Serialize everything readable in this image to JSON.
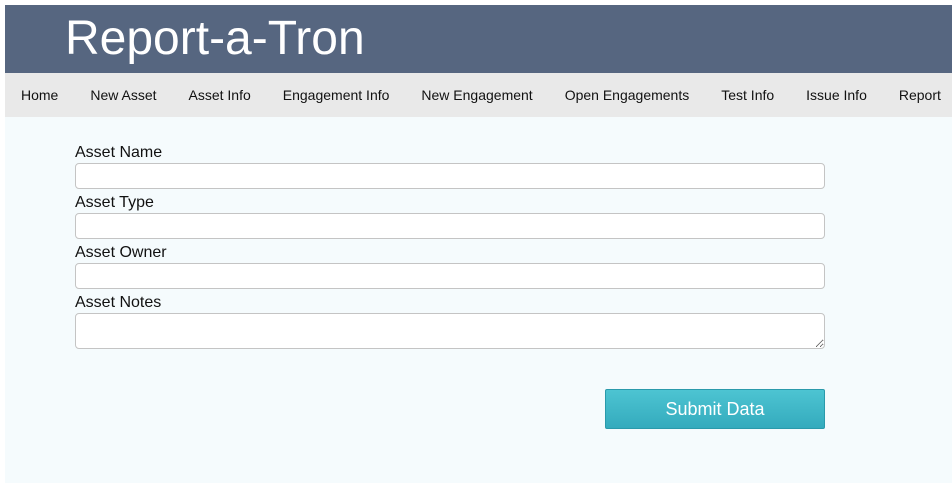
{
  "header": {
    "title": "Report-a-Tron"
  },
  "nav": {
    "items": [
      {
        "label": "Home"
      },
      {
        "label": "New Asset"
      },
      {
        "label": "Asset Info"
      },
      {
        "label": "Engagement Info"
      },
      {
        "label": "New Engagement"
      },
      {
        "label": "Open Engagements"
      },
      {
        "label": "Test Info"
      },
      {
        "label": "Issue Info"
      },
      {
        "label": "Report"
      }
    ]
  },
  "form": {
    "asset_name": {
      "label": "Asset Name",
      "value": "",
      "placeholder": ""
    },
    "asset_type": {
      "label": "Asset Type",
      "value": "",
      "placeholder": ""
    },
    "asset_owner": {
      "label": "Asset Owner",
      "value": "",
      "placeholder": ""
    },
    "asset_notes": {
      "label": "Asset Notes",
      "value": "",
      "placeholder": ""
    },
    "submit_label": "Submit Data"
  },
  "colors": {
    "header_bg": "#566680",
    "nav_bg": "#e9e9e9",
    "page_bg": "#f5fbfd",
    "button_bg": "#3db6c6"
  }
}
